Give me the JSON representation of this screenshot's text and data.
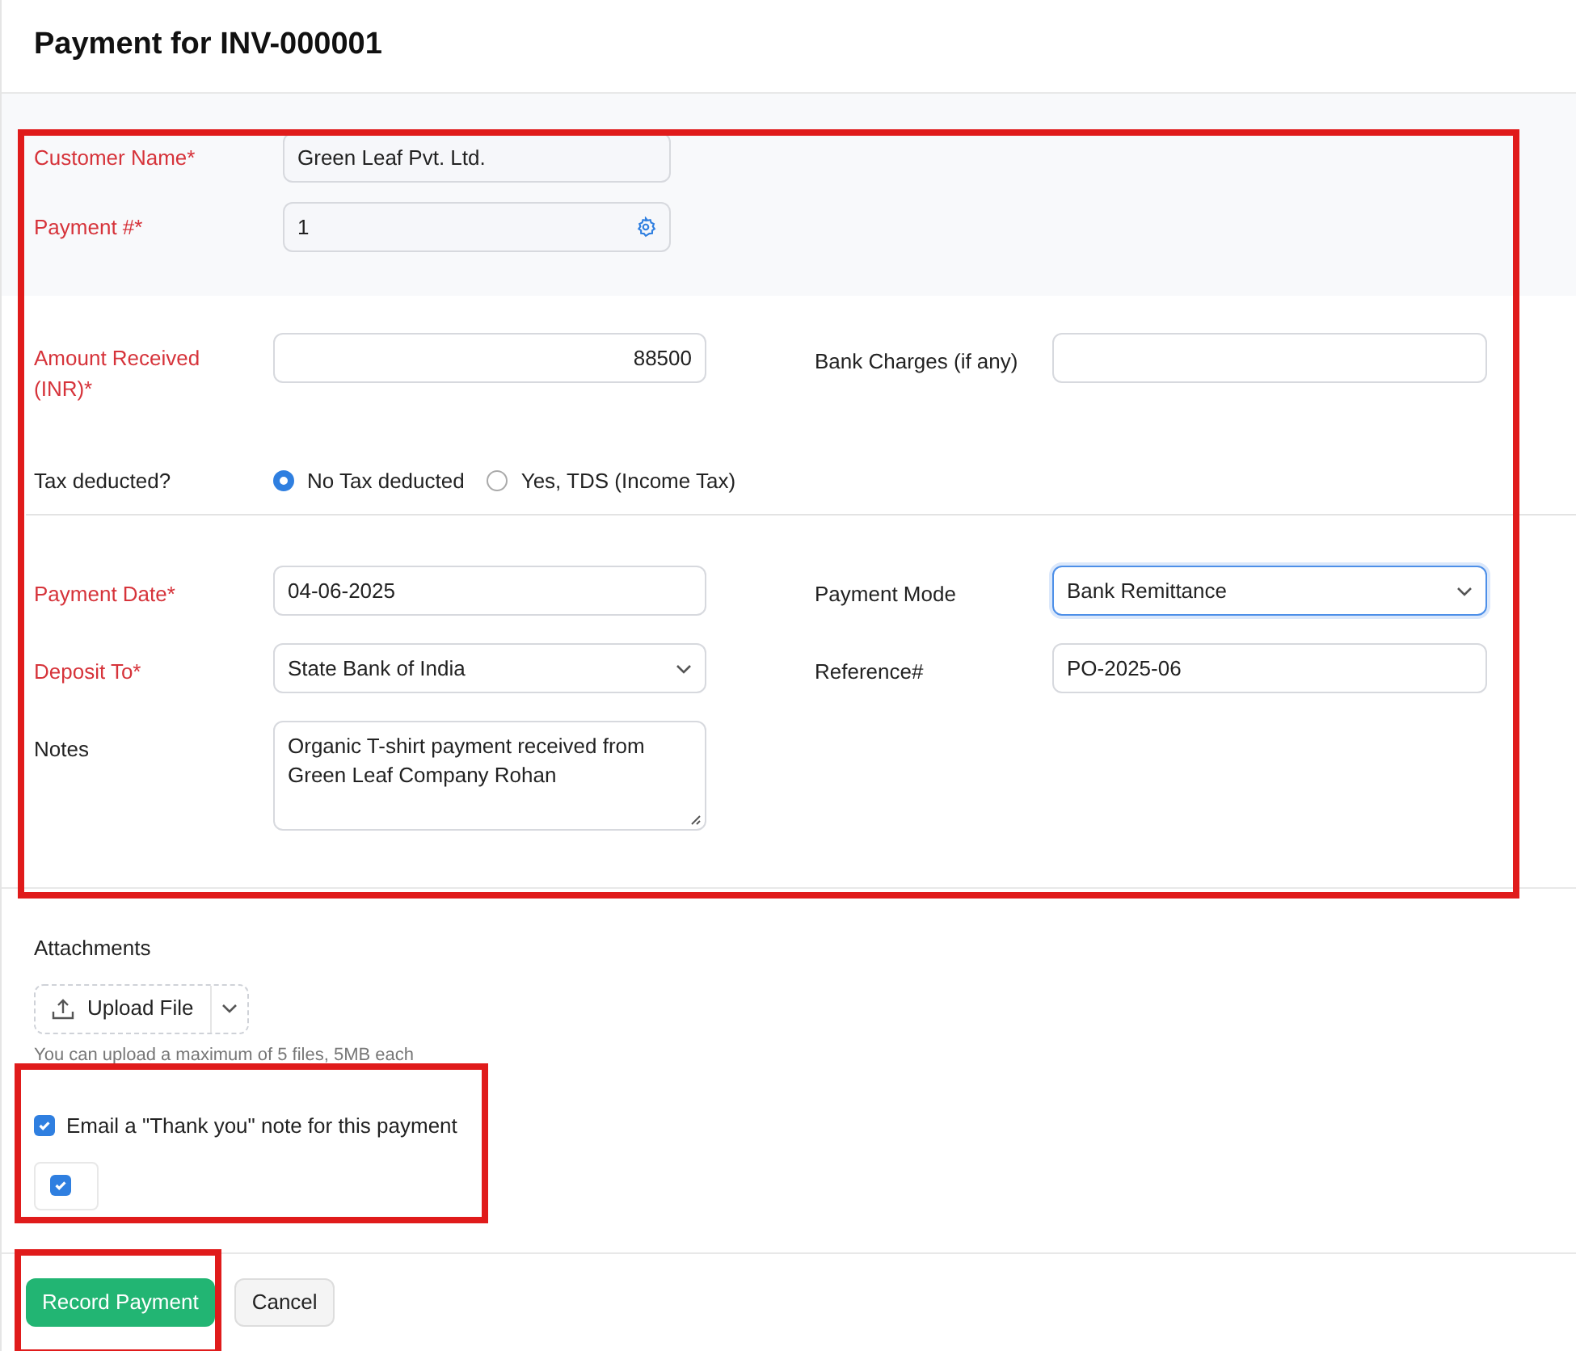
{
  "title": "Payment for INV-000001",
  "header_fields": [
    {
      "label": "Customer Name*",
      "required": true,
      "kind": "text",
      "value": "Green Leaf Pvt. Ltd."
    },
    {
      "label": "Payment #*",
      "required": true,
      "kind": "settings",
      "value": "1"
    }
  ],
  "amount": {
    "label": "Amount Received (INR)*",
    "required": true,
    "kind": "number",
    "value": "88500"
  },
  "bank_charges": {
    "label": "Bank Charges (if any)",
    "required": false,
    "kind": "text"
  },
  "tax": {
    "label": "Tax deducted?",
    "options": [
      {
        "label": "No Tax deducted",
        "selected": true
      },
      {
        "label": "Yes, TDS (Income Tax)",
        "selected": false
      }
    ]
  },
  "rows": [
    {
      "left": {
        "label": "Payment Date*",
        "required": true,
        "kind": "text",
        "value": "04-06-2025"
      },
      "right": {
        "label": "Payment Mode",
        "required": false,
        "kind": "select",
        "value": "Bank Remittance",
        "focused": true
      }
    },
    {
      "left": {
        "label": "Deposit To*",
        "required": true,
        "kind": "select",
        "value": "State Bank of India"
      },
      "right": {
        "label": "Reference#",
        "required": false,
        "kind": "text",
        "value": "PO-2025-06"
      }
    },
    {
      "left": {
        "label": "Notes",
        "required": false,
        "kind": "textarea",
        "value": "Organic T-shirt payment received from Green Leaf Company Rohan"
      }
    }
  ],
  "attachments": {
    "label": "Attachments",
    "button": "Upload File",
    "hint": "You can upload a maximum of 5 files, 5MB each"
  },
  "email_note": {
    "label": "Email a \"Thank you\" note for this payment",
    "checked": true,
    "contact_checked": true
  },
  "buttons": [
    {
      "label": "Record Payment",
      "kind": "primary"
    },
    {
      "label": "Cancel",
      "kind": "secondary"
    }
  ]
}
